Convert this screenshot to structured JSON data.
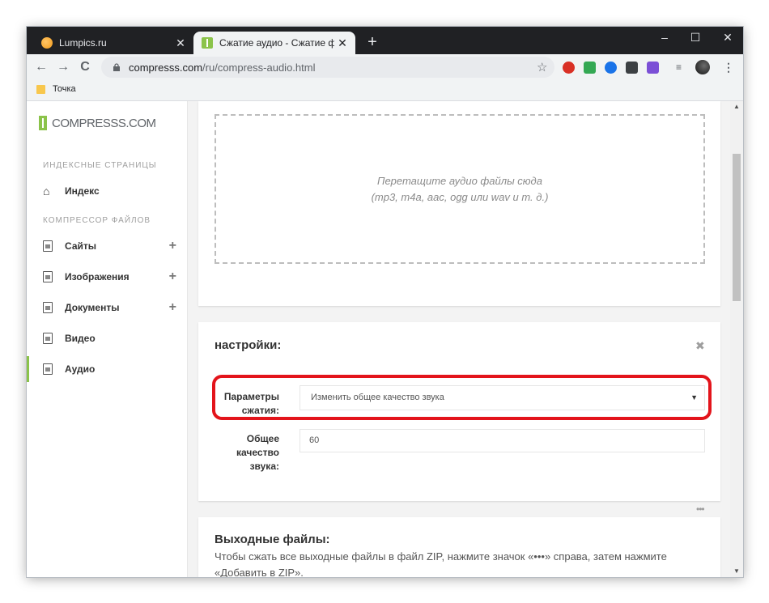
{
  "browser": {
    "tabs": [
      {
        "title": "Lumpics.ru",
        "close": "✕"
      },
      {
        "title": "Сжатие аудио - Сжатие файлов",
        "close": "✕"
      }
    ],
    "new_tab": "+",
    "window_controls": {
      "minimize": "–",
      "maximize": "☐",
      "close": "✕"
    },
    "nav": {
      "back": "←",
      "forward": "→",
      "reload": "C"
    },
    "url_host": "compresss.com",
    "url_path": "/ru/compress-audio.html",
    "star": "☆",
    "bookmark": "Точка"
  },
  "sidebar": {
    "logo_text": "COMPRESSS.COM",
    "section1": "ИНДЕКСНЫЕ СТРАНИЦЫ",
    "home": "Индекс",
    "section2": "КОМПРЕССОР ФАЙЛОВ",
    "items": [
      {
        "label": "Сайты",
        "plus": "+"
      },
      {
        "label": "Изображения",
        "plus": "+"
      },
      {
        "label": "Документы",
        "plus": "+"
      },
      {
        "label": "Видео"
      },
      {
        "label": "Аудио"
      }
    ]
  },
  "dropzone": {
    "line1": "Перетащите аудио файлы сюда",
    "line2": "(mp3, m4a, aac, ogg или wav и т. д.)"
  },
  "settings": {
    "title": "настройки:",
    "close": "✖",
    "compression_label_1": "Параметры",
    "compression_label_2": "сжатия:",
    "compression_value": "Изменить общее качество звука",
    "caret": "▼",
    "quality_label_1": "Общее",
    "quality_label_2": "качество",
    "quality_label_3": "звука:",
    "quality_value": "60"
  },
  "output": {
    "title": "Выходные файлы:",
    "menu": "•••",
    "text": "Чтобы сжать все выходные файлы в файл ZIP, нажмите значок «•••» справа, затем нажмите «Добавить в ZIP»."
  }
}
